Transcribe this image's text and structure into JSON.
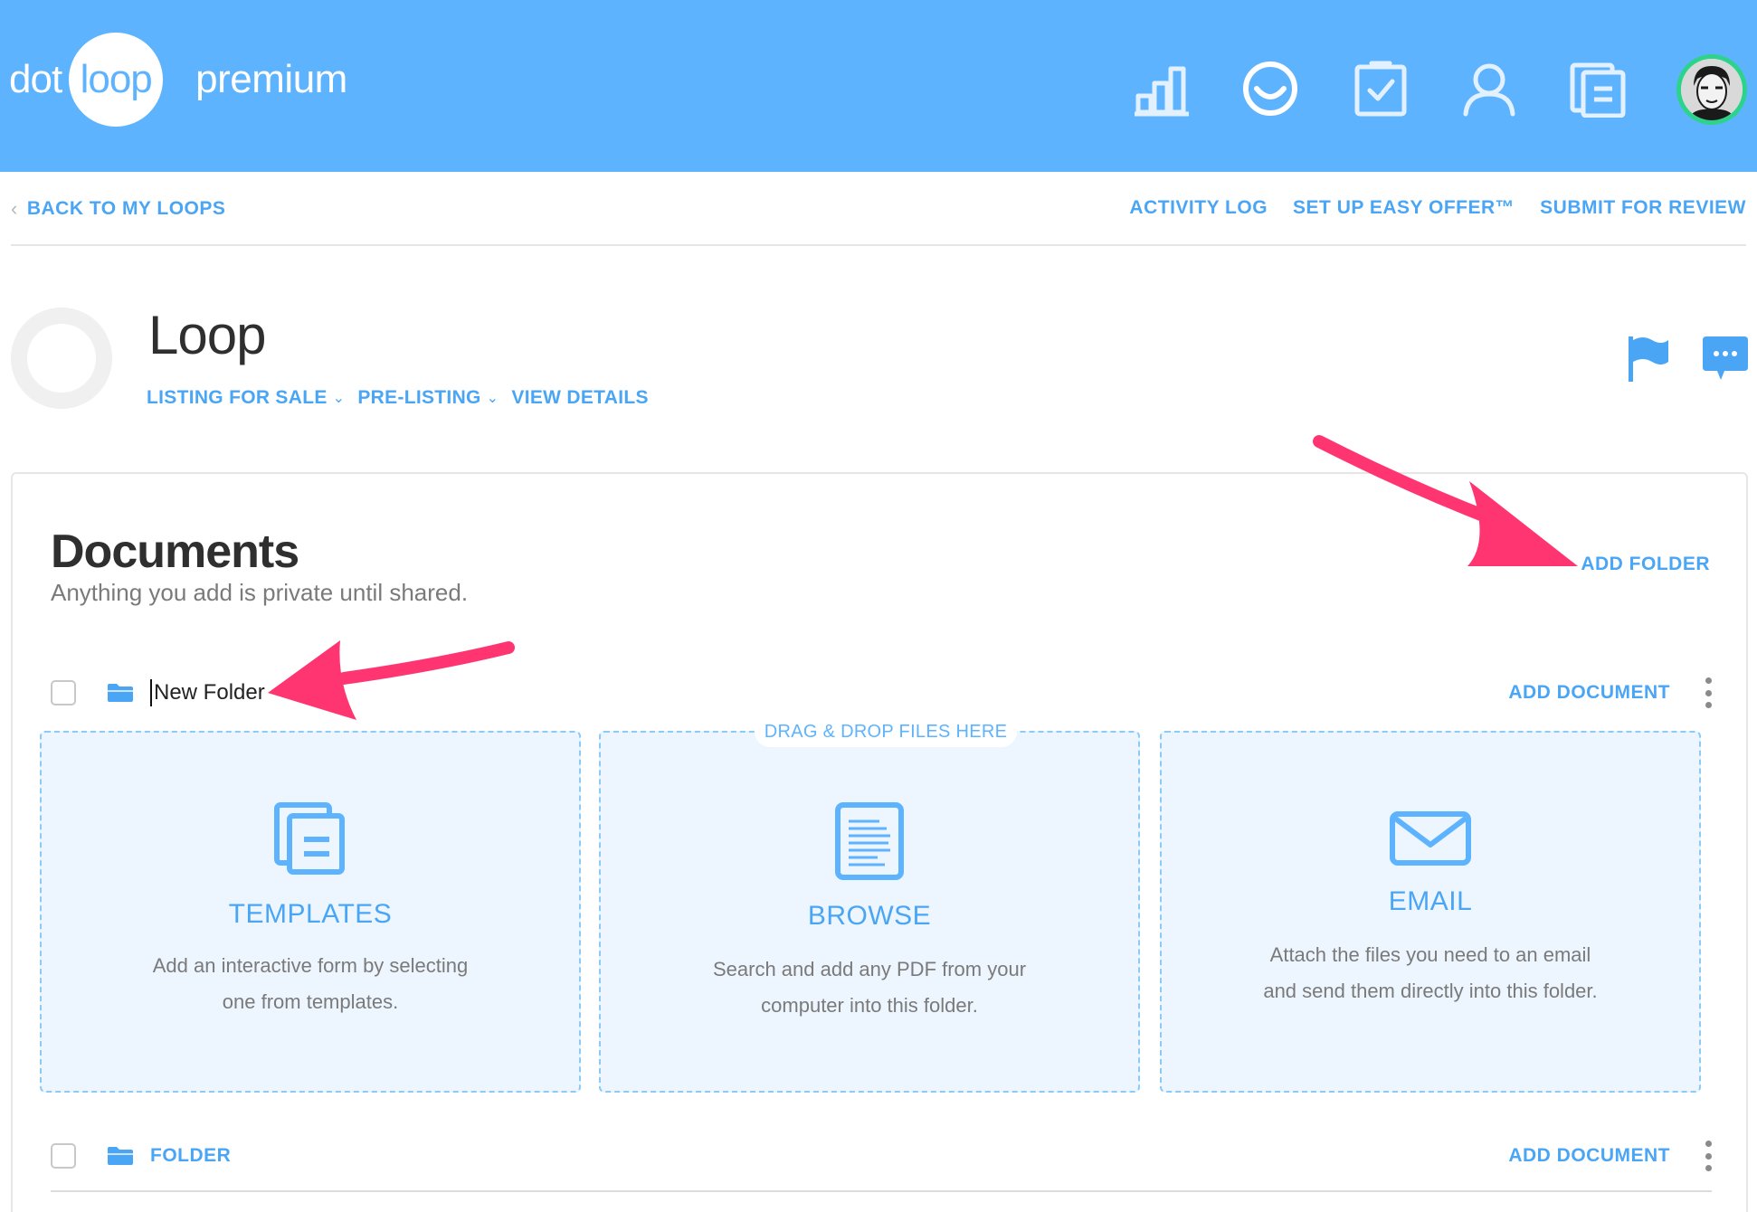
{
  "header": {
    "logo_left": "dot",
    "logo_circle": "loop",
    "logo_suffix": "premium",
    "icons": [
      "bar-chart-icon",
      "smile-icon",
      "checklist-icon",
      "user-icon",
      "documents-icon"
    ],
    "avatar": "avatar",
    "bg_color": "#5eb3ff",
    "avatar_ring_color": "#2cd38a"
  },
  "subnav": {
    "back": "BACK TO MY LOOPS",
    "links": [
      "ACTIVITY LOG",
      "SET UP EASY OFFER™",
      "SUBMIT FOR REVIEW"
    ]
  },
  "loop": {
    "title": "Loop",
    "tags": [
      {
        "label": "LISTING FOR SALE",
        "dropdown": true
      },
      {
        "label": "PRE-LISTING",
        "dropdown": true
      },
      {
        "label": "VIEW DETAILS",
        "dropdown": false
      }
    ],
    "icons": [
      "flag-icon",
      "chat-icon"
    ]
  },
  "documents": {
    "title": "Documents",
    "subtitle": "Anything you add is private until shared.",
    "add_folder": "ADD FOLDER",
    "drop_hint": "DRAG & DROP FILES HERE",
    "folders": [
      {
        "name": "New Folder",
        "editing": true,
        "add_document": "ADD DOCUMENT"
      },
      {
        "name": "FOLDER",
        "editing": false,
        "add_document": "ADD DOCUMENT"
      }
    ],
    "cards": [
      {
        "icon": "templates-icon",
        "title": "TEMPLATES",
        "desc_line1": "Add an interactive form by selecting",
        "desc_line2": "one from templates."
      },
      {
        "icon": "browse-icon",
        "title": "BROWSE",
        "desc_line1": "Search and add any PDF from your",
        "desc_line2": "computer into this folder."
      },
      {
        "icon": "email-icon",
        "title": "EMAIL",
        "desc_line1": "Attach the files you need to an email",
        "desc_line2": "and send them directly into this folder."
      }
    ],
    "accent_color": "#4aa6f4",
    "annotation_color": "#ff3572"
  }
}
